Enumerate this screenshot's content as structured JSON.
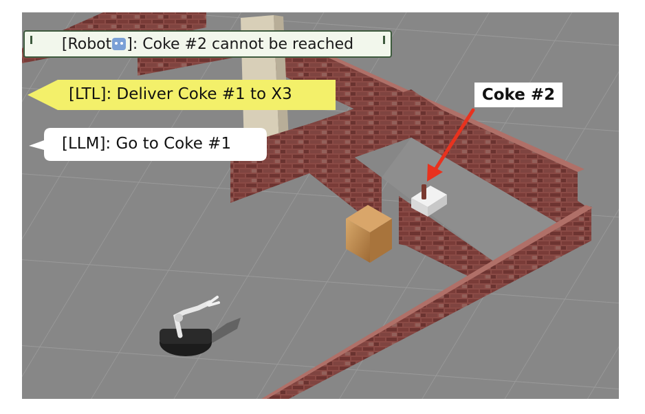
{
  "banner": {
    "prefix": "[Robot",
    "icon": "robot-emoji-icon",
    "suffix": "]: Coke #2 cannot be reached"
  },
  "ltl": {
    "text": "[LTL]: Deliver Coke #1 to X3"
  },
  "llm": {
    "text": "[LLM]: Go to Coke #1"
  },
  "annotation": {
    "text": "Coke #2",
    "arrow_color": "#e8321e"
  },
  "colors": {
    "floor": "#878787",
    "ltl_bubble": "#f3f06a",
    "banner_bg": "#f2f7ec",
    "banner_border": "#3d5a3d",
    "brick": "#7d3f3a"
  }
}
